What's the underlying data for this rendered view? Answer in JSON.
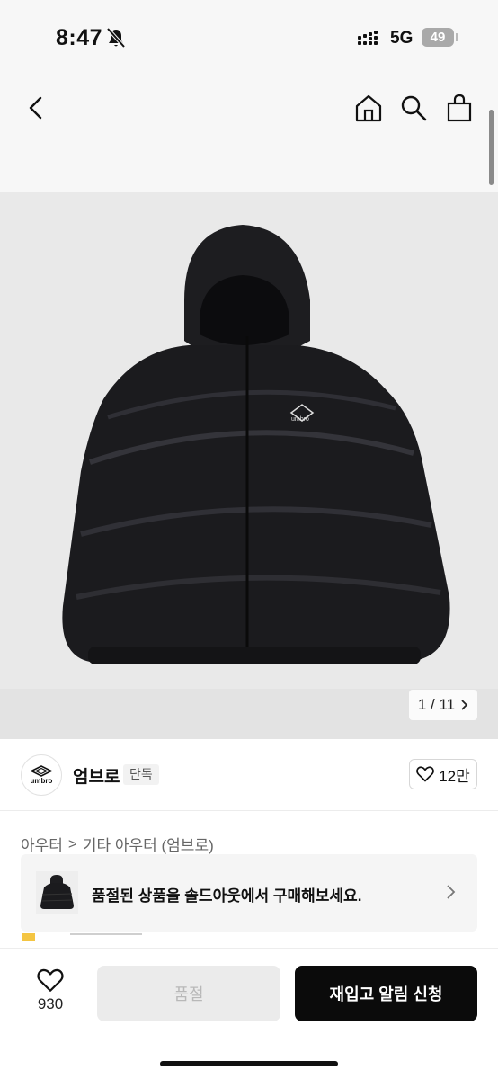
{
  "status_bar": {
    "time": "8:47",
    "network": "5G",
    "battery": "49"
  },
  "nav": {
    "back_icon": "chevron-left-icon",
    "home_icon": "home-icon",
    "search_icon": "search-icon",
    "bag_icon": "shopping-bag-icon"
  },
  "gallery": {
    "counter": "1 / 11",
    "logo_text": "umbro"
  },
  "brand": {
    "logo_text": "umbro",
    "name": "엄브로",
    "badge": "단독",
    "wish_count": "12만"
  },
  "breadcrumb": {
    "category": "아우터",
    "separator": ">",
    "subcategory": "기타 아우터 (엄브로)"
  },
  "banner": {
    "text": "품절된 상품을 솔드아웃에서 구매해보세요."
  },
  "bottom_bar": {
    "wish_count": "930",
    "soldout_label": "품절",
    "restock_label": "재입고 알림 신청"
  },
  "colors": {
    "accent": "#0b0b0b",
    "background": "#f7f7f7",
    "disabled": "#ebebeb"
  }
}
